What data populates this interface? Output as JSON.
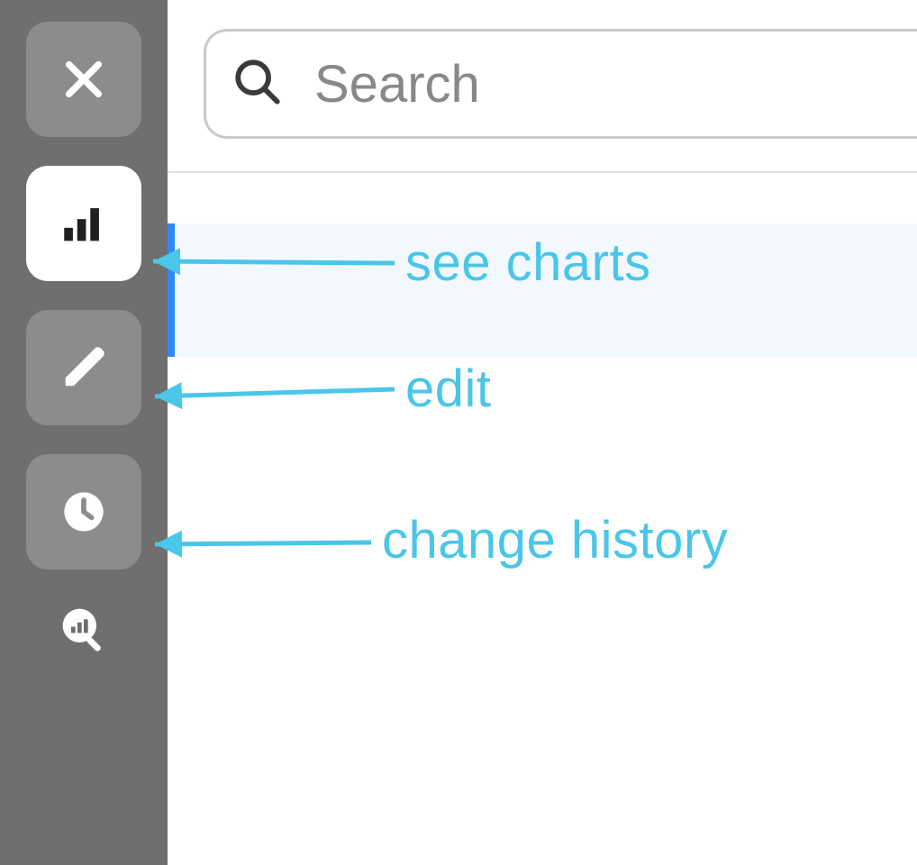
{
  "sidebar": {
    "close_name": "close",
    "charts_name": "bar-chart",
    "edit_name": "pencil",
    "history_name": "clock",
    "zoom_chart_name": "chart-zoom"
  },
  "search": {
    "placeholder": "Search",
    "value": ""
  },
  "annotations": {
    "charts": "see charts",
    "edit": "edit",
    "history": "change history"
  },
  "colors": {
    "sidebar_bg": "#6f6f6f",
    "btn_bg": "#8c8c8c",
    "btn_active_bg": "#ffffff",
    "icon_dark": "#202020",
    "icon_light": "#ffffff",
    "accent_blue": "#2f87ff",
    "annotation_cyan": "#49c6e8"
  }
}
